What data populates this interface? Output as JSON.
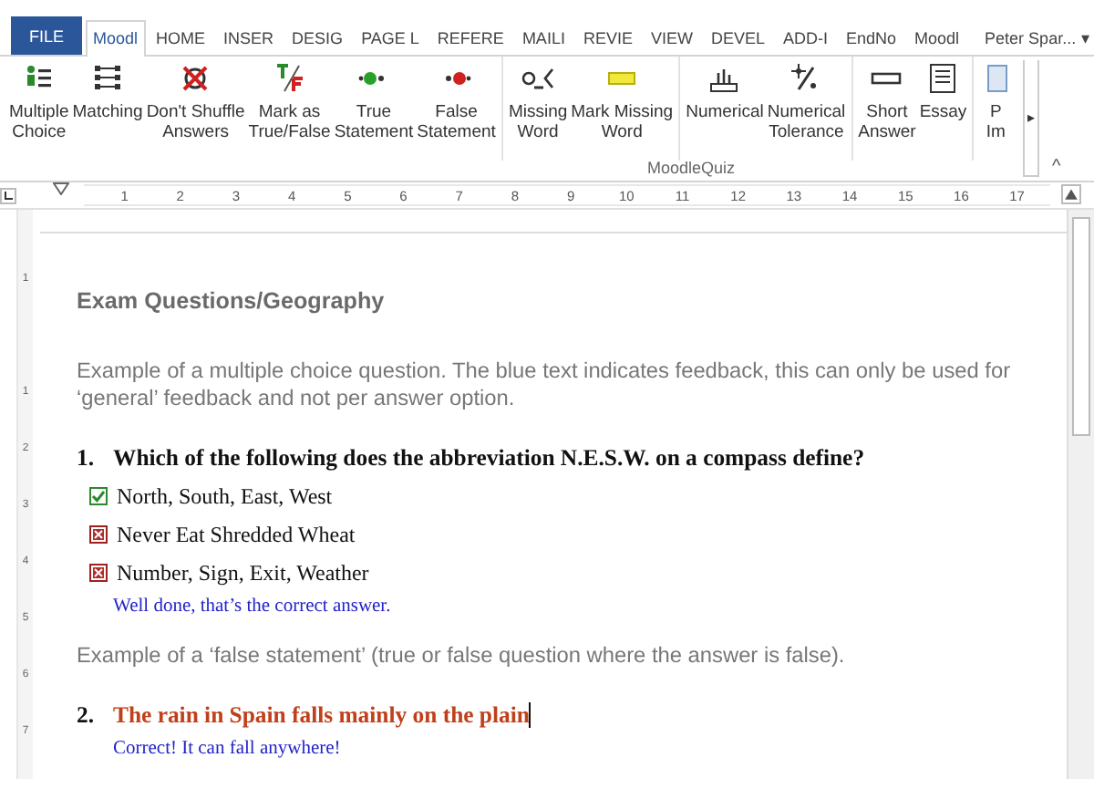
{
  "tabs": [
    {
      "label": "FILE",
      "kind": "file",
      "selected": false
    },
    {
      "label": "Moodl",
      "kind": "tab",
      "selected": true
    },
    {
      "label": "HOME",
      "kind": "tab",
      "selected": false
    },
    {
      "label": "INSER",
      "kind": "tab",
      "selected": false
    },
    {
      "label": "DESIG",
      "kind": "tab",
      "selected": false
    },
    {
      "label": "PAGE L",
      "kind": "tab",
      "selected": false
    },
    {
      "label": "REFERE",
      "kind": "tab",
      "selected": false
    },
    {
      "label": "MAILI",
      "kind": "tab",
      "selected": false
    },
    {
      "label": "REVIE",
      "kind": "tab",
      "selected": false
    },
    {
      "label": "VIEW",
      "kind": "tab",
      "selected": false
    },
    {
      "label": "DEVEL",
      "kind": "tab",
      "selected": false
    },
    {
      "label": "ADD-I",
      "kind": "tab",
      "selected": false
    },
    {
      "label": "EndNo",
      "kind": "tab",
      "selected": false
    },
    {
      "label": "Moodl",
      "kind": "tab",
      "selected": false
    }
  ],
  "account": {
    "name": "Peter Spar...",
    "caret": "▾"
  },
  "ribbon": {
    "groups": [
      [
        {
          "kind": "multiple-choice",
          "lines": [
            "Multiple",
            "Choice"
          ]
        },
        {
          "kind": "matching",
          "lines": [
            "Matching"
          ]
        },
        {
          "kind": "no-shuffle",
          "lines": [
            "Don't Shuffle",
            "Answers"
          ]
        },
        {
          "kind": "true-false",
          "lines": [
            "Mark as",
            "True/False"
          ]
        },
        {
          "kind": "true-statement",
          "lines": [
            "True",
            "Statement"
          ]
        },
        {
          "kind": "false-statement",
          "lines": [
            "False",
            "Statement"
          ]
        }
      ],
      [
        {
          "kind": "missing-word",
          "lines": [
            "Missing",
            "Word"
          ]
        },
        {
          "kind": "mark-missing",
          "lines": [
            "Mark Missing",
            "Word"
          ]
        }
      ],
      [
        {
          "kind": "numerical",
          "lines": [
            "Numerical"
          ]
        },
        {
          "kind": "tolerance",
          "lines": [
            "Numerical",
            "Tolerance"
          ]
        }
      ],
      [
        {
          "kind": "short-answer",
          "lines": [
            "Short",
            "Answer"
          ]
        },
        {
          "kind": "essay",
          "lines": [
            "Essay"
          ]
        }
      ],
      [
        {
          "kind": "partial",
          "lines": [
            "P",
            "Im"
          ]
        }
      ]
    ],
    "group_label": "MoodleQuiz",
    "more": "▸",
    "collapse": "^"
  },
  "ruler": {
    "numbers": [
      "1",
      "2",
      "3",
      "4",
      "5",
      "6",
      "7",
      "8",
      "9",
      "10",
      "11",
      "12",
      "13",
      "14",
      "15",
      "16",
      "17"
    ],
    "vertical": [
      "1",
      "1",
      "2",
      "3",
      "4",
      "5",
      "6",
      "7"
    ]
  },
  "document": {
    "heading": "Exam Questions/Geography",
    "intro": "Example of a multiple choice question. The blue text indicates feedback, this can only be used for ‘general’ feedback and not per answer option.",
    "question_1": {
      "number": "1.",
      "text": "Which of the following does the abbreviation N.E.S.W. on a compass define?",
      "color": "#111111",
      "cursor": false,
      "options": [
        {
          "text": "North, South, East, West",
          "correct": true
        },
        {
          "text": "Never Eat Shredded Wheat",
          "correct": false
        },
        {
          "text": "Number, Sign, Exit, Weather",
          "correct": false
        }
      ],
      "feedback": "Well done, that’s the correct answer."
    },
    "between": "Example of a ‘false statement’ (true or false question where the answer is false).",
    "question_2": {
      "number": "2.",
      "text": "The rain in Spain falls mainly on the plain",
      "color": "#c0401a",
      "cursor": true,
      "feedback": "Correct! It can fall anywhere!"
    }
  }
}
